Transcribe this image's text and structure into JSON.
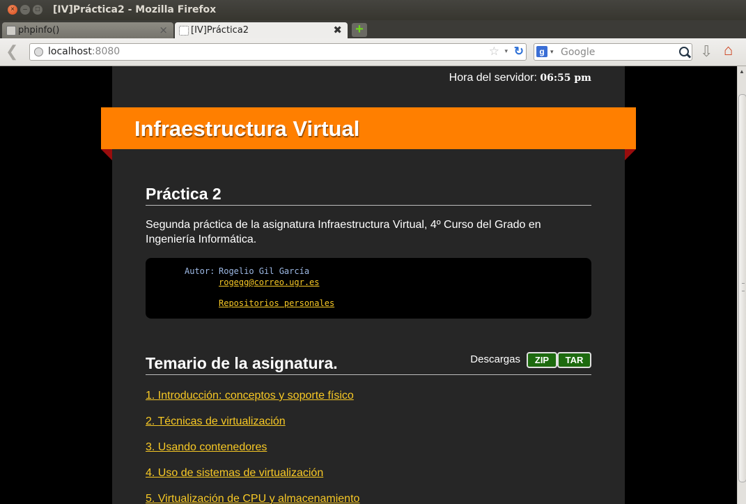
{
  "window": {
    "title": "[IV]Práctica2 - Mozilla Firefox"
  },
  "tabs": [
    {
      "label": "phpinfo()",
      "active": false
    },
    {
      "label": "[IV]Práctica2",
      "active": true
    }
  ],
  "navbar": {
    "url_host": "localhost",
    "url_port": ":8080",
    "search_placeholder": "Google",
    "search_engine_letter": "g"
  },
  "page": {
    "clock_label": "Hora del servidor:",
    "clock_time": "06:55 pm",
    "banner_title": "Infraestructura Virtual",
    "practice_heading": "Práctica 2",
    "intro": "Segunda práctica de la asignatura Infraestructura Virtual, 4º Curso del Grado en Ingeniería Informática.",
    "author_label": "Autor:",
    "author_name": "Rogelio Gil García",
    "author_email": "rogegg@correo.ugr.es",
    "repos_link": "Repositorios personales",
    "syllabus_heading": "Temario de la asignatura.",
    "downloads_label": "Descargas",
    "zip_label": "ZIP",
    "tar_label": "TAR",
    "topics": [
      "1. Introducción: conceptos y soporte físico",
      "2. Técnicas de virtualización",
      "3. Usando contenedores",
      "4. Uso de sistemas de virtualización",
      "5. Virtualización de CPU y almacenamiento"
    ]
  },
  "colors": {
    "banner": "#ff7f00",
    "link": "#f8c925",
    "page_bg": "#262626",
    "button_bg": "#1d6a0f"
  }
}
